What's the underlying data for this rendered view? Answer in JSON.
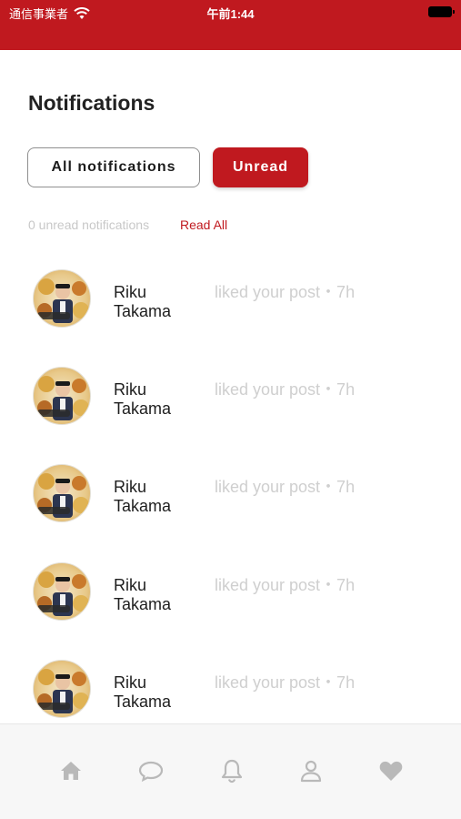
{
  "status_bar": {
    "carrier": "通信事業者",
    "time": "午前1:44"
  },
  "header": {
    "title": "Notifications"
  },
  "tabs": {
    "all_label": "All notifications",
    "unread_label": "Unread",
    "active": "Unread"
  },
  "summary": {
    "unread_text": "0 unread notifications",
    "read_all_label": "Read All"
  },
  "notifications": [
    {
      "name": "Riku Takama",
      "message": "liked your post・7h"
    },
    {
      "name": "Riku Takama",
      "message": "liked your post・7h"
    },
    {
      "name": "Riku Takama",
      "message": "liked your post・7h"
    },
    {
      "name": "Riku Takama",
      "message": "liked your post・7h"
    },
    {
      "name": "Riku Takama",
      "message": "liked your post・7h"
    }
  ],
  "bottom_nav": {
    "items": [
      "home-icon",
      "chat-icon",
      "bell-icon",
      "user-icon",
      "heart-icon"
    ]
  },
  "colors": {
    "brand": "#c0191f",
    "muted_text": "#cfcfcf",
    "nav_icon": "#b9b9b9"
  }
}
